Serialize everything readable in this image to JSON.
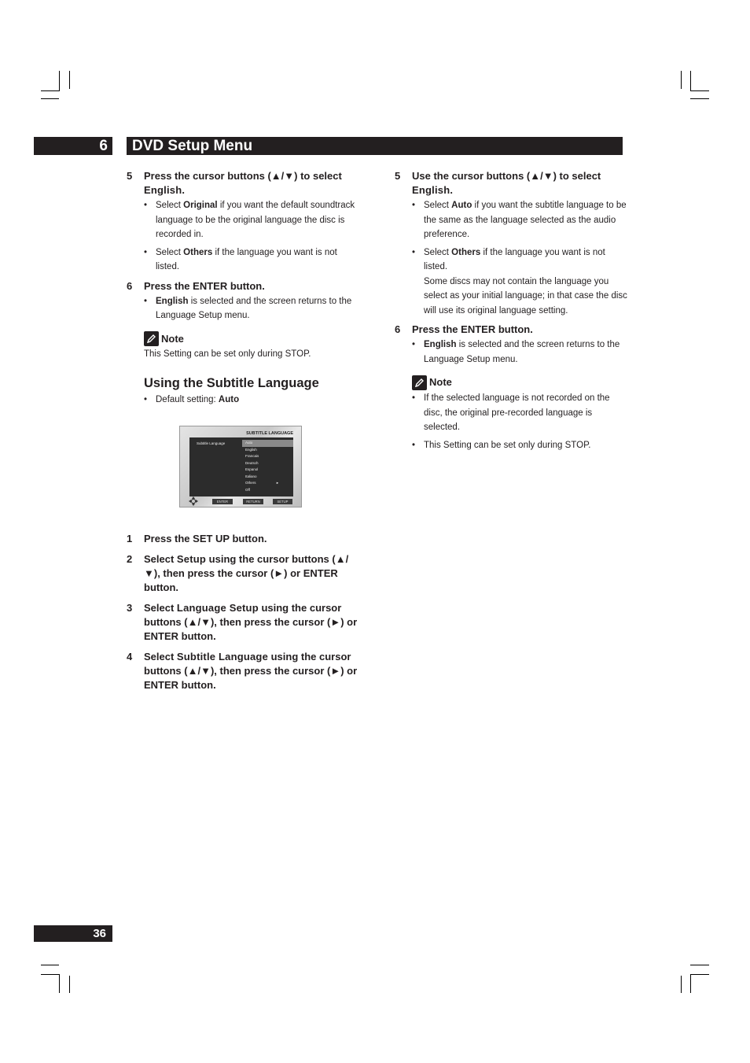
{
  "header": {
    "chapter_number": "6",
    "chapter_title": "DVD Setup Menu"
  },
  "footer": {
    "page_number": "36"
  },
  "left_column": {
    "step5": {
      "num": "5",
      "text_a": "Press the cursor buttons (▲/▼) to select ",
      "text_b": "English",
      "text_c": ".",
      "bullets": [
        {
          "pre": "Select ",
          "bold": "Original",
          "post": " if you want the default soundtrack language to be the original language the disc is recorded in."
        },
        {
          "pre": "Select ",
          "bold": "Others",
          "post": " if the language you want is not listed."
        }
      ]
    },
    "step6": {
      "num": "6",
      "text": "Press the ENTER button.",
      "bullets": [
        {
          "pre": "",
          "bold": "English",
          "post": " is selected and the screen returns to the Language Setup menu."
        }
      ]
    },
    "note": {
      "label": "Note",
      "text": "This Setting can be set only during STOP."
    },
    "section": {
      "title": "Using the Subtitle Language",
      "default_pre": "Default setting: ",
      "default_value": "Auto"
    },
    "screen": {
      "title": "SUBTITLE LANGUAGE",
      "label": "Subtitle Language",
      "options": [
        "Auto",
        "English",
        "Francais",
        "Deutsch",
        "Espanol",
        "Italiano",
        "Others",
        "Off"
      ],
      "selected": "Auto",
      "others_arrow": "►",
      "buttons": [
        "ENTER",
        "RETURN",
        "SETUP"
      ]
    },
    "steps": [
      {
        "num": "1",
        "parts": [
          {
            "t": "Press the SET UP button.",
            "h": false
          }
        ]
      },
      {
        "num": "2",
        "parts": [
          {
            "t": "Select ",
            "h": false
          },
          {
            "t": "Setup",
            "h": true
          },
          {
            "t": " using the cursor buttons (▲/▼), then press the cursor (►) or ENTER button.",
            "h": false
          }
        ]
      },
      {
        "num": "3",
        "parts": [
          {
            "t": "Select ",
            "h": false
          },
          {
            "t": "Language Setup",
            "h": true
          },
          {
            "t": " using the cursor buttons (▲/▼), then press the cursor (►) or ENTER button.",
            "h": false
          }
        ]
      },
      {
        "num": "4",
        "parts": [
          {
            "t": "Select ",
            "h": false
          },
          {
            "t": "Subtitle Language",
            "h": true
          },
          {
            "t": " using the cursor buttons (▲/▼), then press the cursor (►) or ENTER button.",
            "h": false
          }
        ]
      }
    ]
  },
  "right_column": {
    "step5": {
      "num": "5",
      "text_a": "Use the cursor buttons (▲/▼) to select ",
      "text_b": "English",
      "text_c": ".",
      "bullets": [
        {
          "pre": "Select ",
          "bold": "Auto",
          "post": " if you want the subtitle language to be the same as the language selected as the audio preference."
        },
        {
          "pre": "Select ",
          "bold": "Others",
          "post": " if the language you want is not listed.",
          "extra": "Some discs may not contain the language you select as your initial language; in that case the disc will use its original language setting."
        }
      ]
    },
    "step6": {
      "num": "6",
      "text": "Press the ENTER button.",
      "bullets": [
        {
          "pre": "",
          "bold": "English",
          "post": " is selected and the screen returns to the Language Setup menu."
        }
      ]
    },
    "note": {
      "label": "Note",
      "bullets": [
        "If the selected language is not recorded on the disc, the original pre-recorded language is selected.",
        "This Setting can be set only during STOP."
      ]
    }
  }
}
